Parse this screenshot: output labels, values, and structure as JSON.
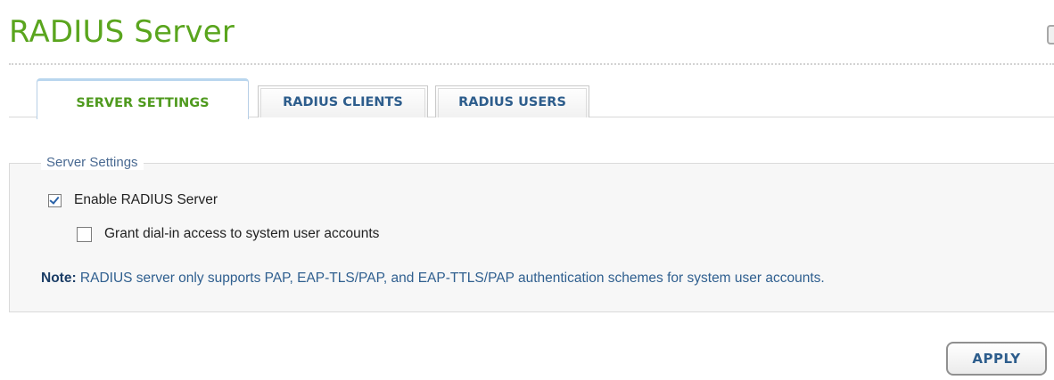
{
  "header": {
    "title": "RADIUS Server"
  },
  "tabs": [
    {
      "label": "SERVER SETTINGS",
      "active": true
    },
    {
      "label": "RADIUS CLIENTS",
      "active": false
    },
    {
      "label": "RADIUS USERS",
      "active": false
    }
  ],
  "server_settings": {
    "legend": "Server Settings",
    "enable_server": {
      "label": "Enable RADIUS Server",
      "checked": true
    },
    "grant_dialin": {
      "label": "Grant dial-in access to system user accounts",
      "checked": false
    },
    "note_prefix": "Note:",
    "note_text": " RADIUS server only supports PAP, EAP-TLS/PAP, and EAP-TTLS/PAP authentication schemes for system user accounts."
  },
  "actions": {
    "apply_label": "APPLY"
  },
  "colors": {
    "title_green": "#5aa51e",
    "tab_blue": "#2d5d8c",
    "active_tab_green": "#4f9a1e",
    "check_blue": "#2a62a8"
  }
}
